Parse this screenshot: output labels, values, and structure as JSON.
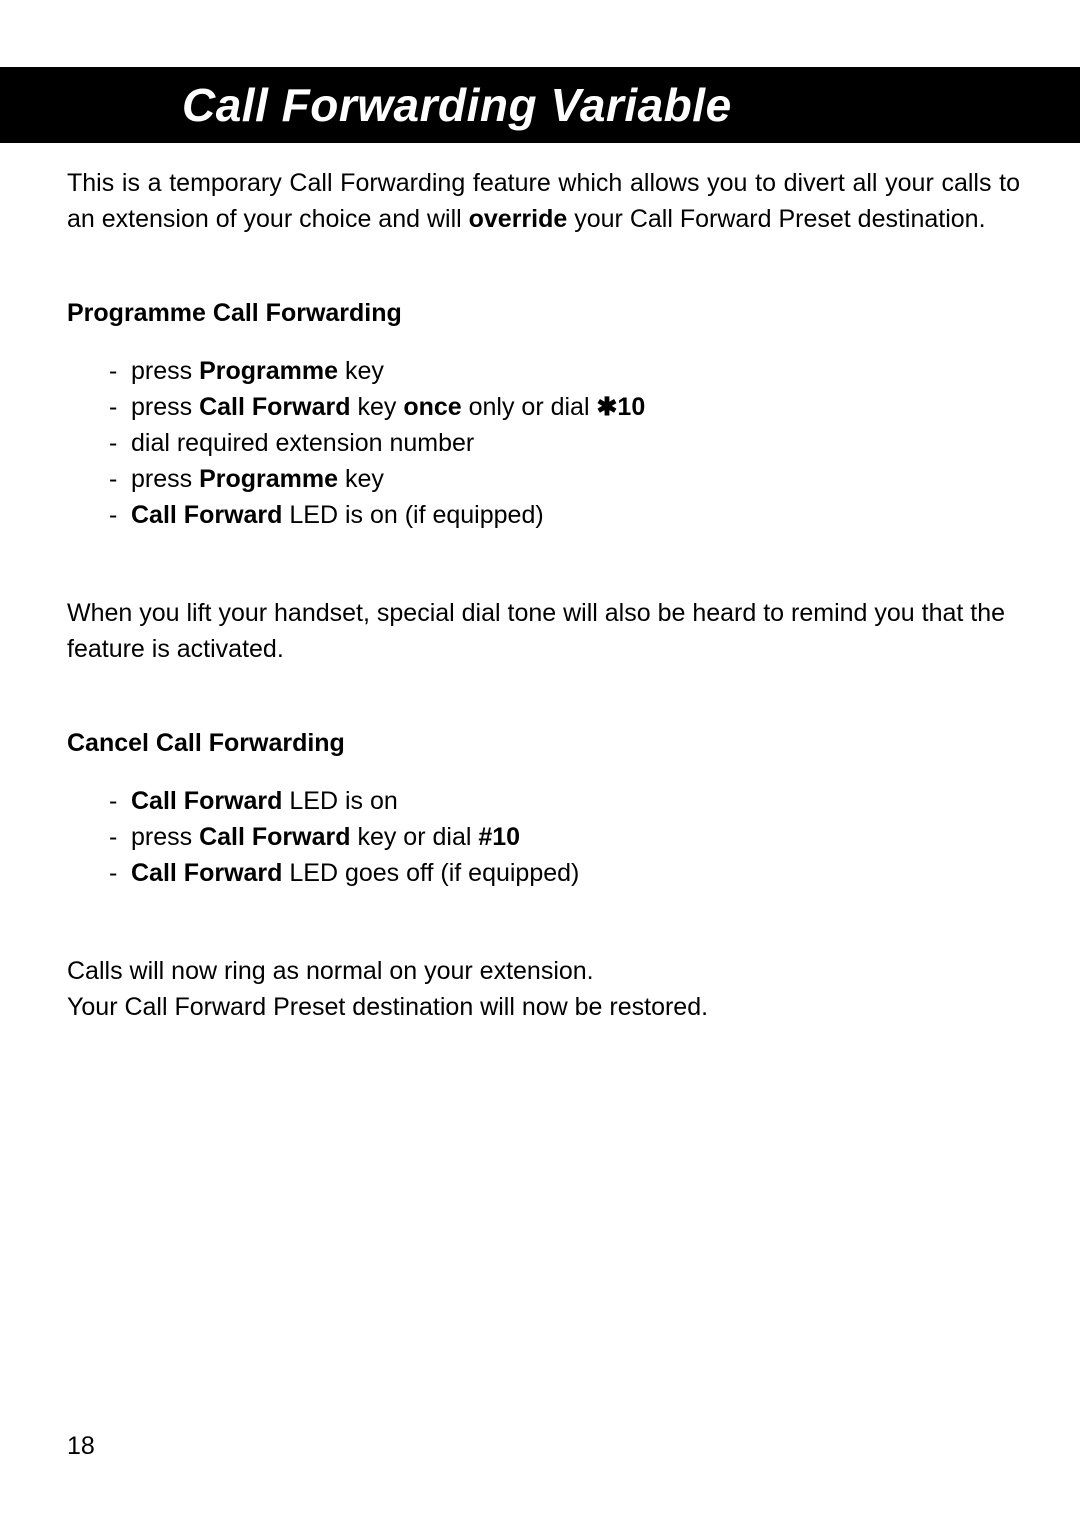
{
  "title": "Call Forwarding Variable",
  "intro": {
    "part1": "This is a temporary Call Forwarding feature which allows you to divert all your calls to an extension of your choice and will ",
    "bold1": "override",
    "part2": " your Call Forward Preset destination."
  },
  "section1": {
    "heading": "Programme Call Forwarding",
    "items": [
      {
        "pre": "press ",
        "b1": "Programme",
        "post": " key"
      },
      {
        "pre": "press ",
        "b1": "Call Forward",
        "mid1": " key ",
        "b2": "once",
        "mid2": " only or dial ",
        "b3": "✱10",
        "post": ""
      },
      {
        "pre": "dial required extension number",
        "b1": "",
        "post": ""
      },
      {
        "pre": "press ",
        "b1": "Programme",
        "post": " key"
      },
      {
        "pre": "",
        "b1": "Call Forward",
        "post": " LED is on (if equipped)"
      }
    ]
  },
  "mid_paragraph": "When you lift your handset, special dial tone will also be heard to remind you that the feature is activated.",
  "section2": {
    "heading": "Cancel Call Forwarding",
    "items": [
      {
        "pre": "",
        "b1": "Call Forward",
        "post": " LED is on"
      },
      {
        "pre": "press ",
        "b1": "Call Forward",
        "mid1": " key or dial ",
        "b2": "#10",
        "post": ""
      },
      {
        "pre": "",
        "b1": "Call Forward",
        "post": " LED goes off (if equipped)"
      }
    ]
  },
  "closing": {
    "line1": "Calls will now ring as normal on your extension.",
    "line2": "Your Call Forward Preset destination will now be restored."
  },
  "page_number": "18"
}
